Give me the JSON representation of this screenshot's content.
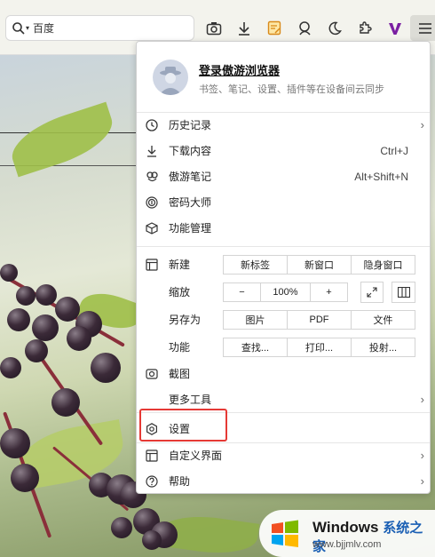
{
  "toolbar": {
    "search_engine": "百度",
    "icons": [
      "screenshot-icon",
      "download-icon",
      "notes-icon",
      "password-icon",
      "night-mode-icon",
      "extensions-icon",
      "v-logo-icon",
      "menu-icon"
    ]
  },
  "menu": {
    "account": {
      "title": "登录傲游浏览器",
      "subtitle": "书签、笔记、设置、插件等在设备间云同步"
    },
    "items": {
      "history": {
        "label": "历史记录",
        "arrow": "›"
      },
      "downloads": {
        "label": "下载内容",
        "shortcut": "Ctrl+J"
      },
      "notes": {
        "label": "傲游笔记",
        "shortcut": "Alt+Shift+N"
      },
      "passwords": {
        "label": "密码大师"
      },
      "features": {
        "label": "功能管理"
      },
      "new": {
        "label": "新建",
        "buttons": [
          "新标签",
          "新窗口",
          "隐身窗口"
        ]
      },
      "zoom": {
        "label": "缩放",
        "minus": "−",
        "value": "100%",
        "plus": "+"
      },
      "saveas": {
        "label": "另存为",
        "buttons": [
          "图片",
          "PDF",
          "文件"
        ]
      },
      "functions": {
        "label": "功能",
        "buttons": [
          "查找...",
          "打印...",
          "投射..."
        ]
      },
      "capture": {
        "label": "截图"
      },
      "more_tools": {
        "label": "更多工具",
        "arrow": "›"
      },
      "settings": {
        "label": "设置"
      },
      "customize": {
        "label": "自定义界面",
        "arrow": "›"
      },
      "help": {
        "label": "帮助",
        "arrow": "›"
      }
    },
    "highlight_color": "#e53935"
  },
  "watermark": {
    "title": "Windows",
    "title_cn": "系统之家",
    "url": "www.bjjmlv.com"
  }
}
